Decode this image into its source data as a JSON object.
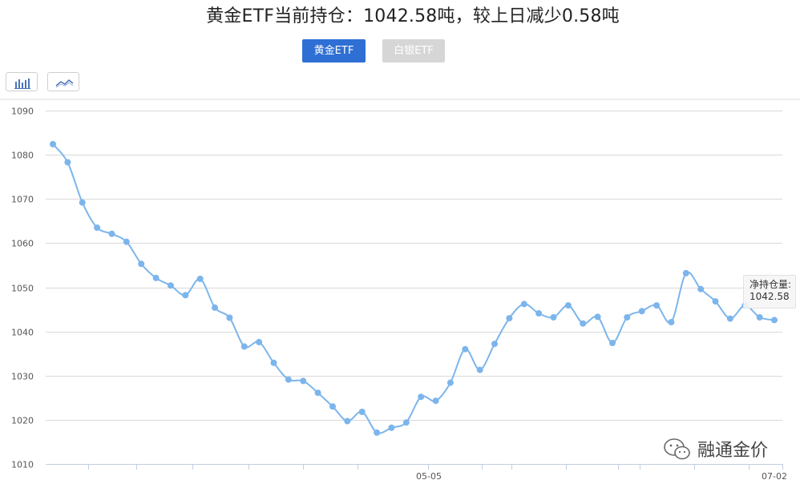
{
  "header": {
    "title": "黄金ETF当前持仓：1042.58吨，较上日减少0.58吨"
  },
  "tabs": [
    {
      "label": "黄金ETF",
      "active": true
    },
    {
      "label": "白银ETF",
      "active": false
    }
  ],
  "toolbar": {
    "bar_icon": "bar-chart-icon",
    "line_icon": "line-chart-icon"
  },
  "tooltip": {
    "label": "净持仓量:",
    "value": "1042.58"
  },
  "watermark": {
    "text": "融通金价",
    "icon": "wechat-icon"
  },
  "colors": {
    "series": "#7cb5ec",
    "active_tab": "#2f6fd4",
    "inactive_tab": "#d6d6d6",
    "grid": "#d9d9d9"
  },
  "chart_data": {
    "type": "line",
    "title": "黄金ETF当前持仓：1042.58吨，较上日减少0.58吨",
    "xlabel": "",
    "ylabel": "",
    "ylim": [
      1010,
      1090
    ],
    "yticks": [
      1010,
      1020,
      1030,
      1040,
      1050,
      1060,
      1070,
      1080,
      1090
    ],
    "xtick_labels": [
      "05-05",
      "07-02"
    ],
    "grid": true,
    "legend": "none",
    "series": [
      {
        "values": [
          1082.4,
          1078.3,
          1069.2,
          1063.5,
          1062.1,
          1060.3,
          1055.3,
          1052.1,
          1050.4,
          1048.2,
          1051.9,
          1045.4,
          1043.1,
          1036.6,
          1037.6,
          1032.9,
          1029.1,
          1028.8,
          1026.1,
          1023.0,
          1019.7,
          1021.8,
          1017.1,
          1018.2,
          1019.4,
          1025.2,
          1024.3,
          1028.4,
          1036.0,
          1031.3,
          1037.2,
          1043.0,
          1046.2,
          1044.1,
          1043.2,
          1045.9,
          1041.8,
          1043.3,
          1037.4,
          1043.2,
          1044.6,
          1045.9,
          1042.1,
          1053.2,
          1049.6,
          1046.8,
          1042.9,
          1045.9,
          1043.2,
          1042.58
        ]
      }
    ]
  }
}
